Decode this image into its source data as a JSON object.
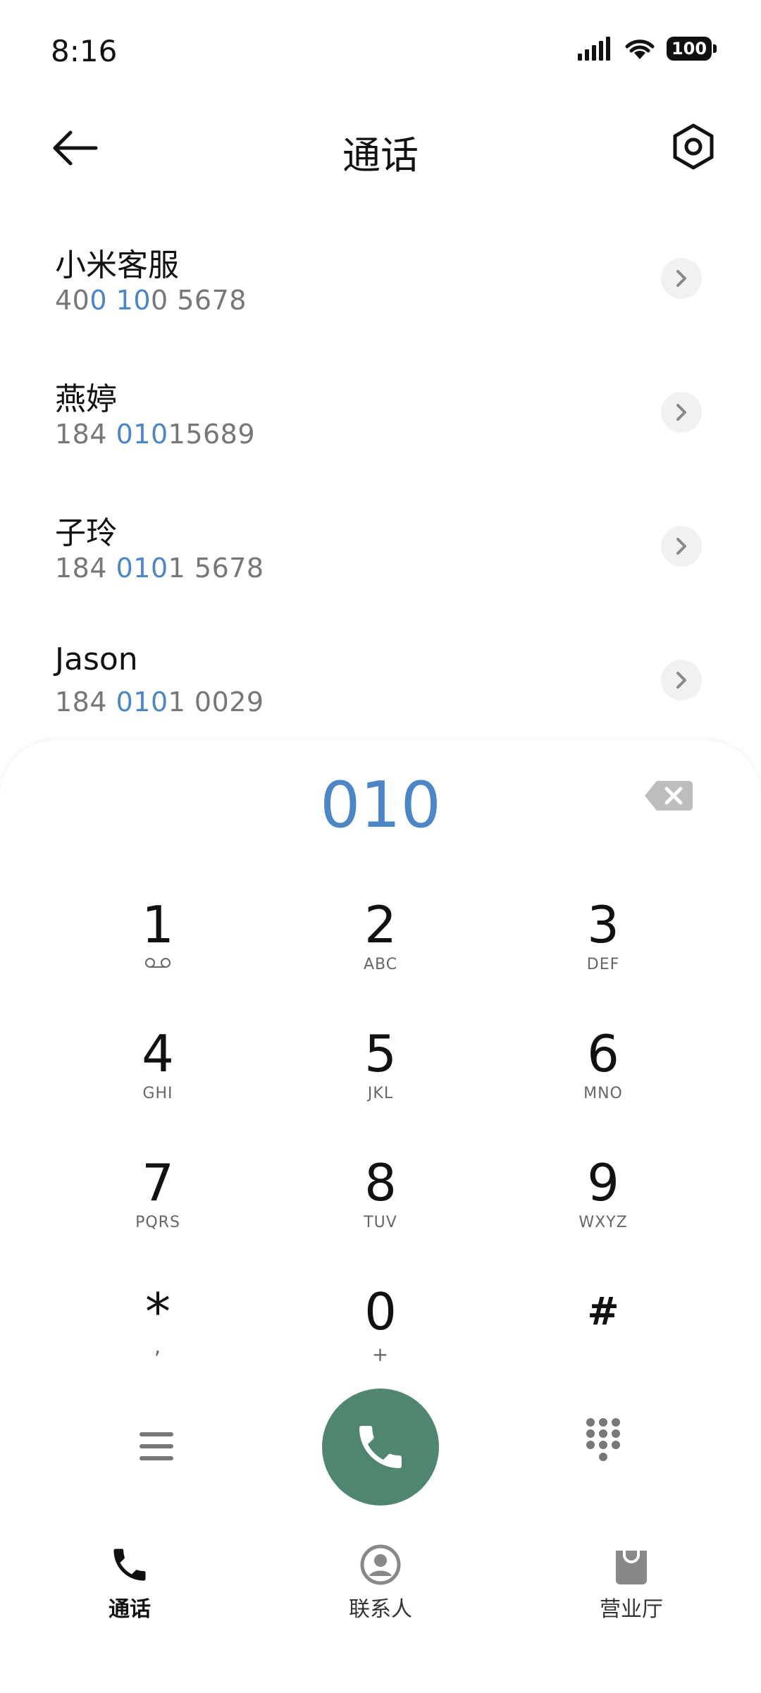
{
  "status_bar": {
    "time": "8:16",
    "battery": "100"
  },
  "header": {
    "title": "通话"
  },
  "contacts": [
    {
      "name": "小米客服",
      "number_parts": [
        "40",
        "0",
        " ",
        "10",
        "0 5678"
      ],
      "highlight": [
        false,
        true,
        false,
        true,
        false
      ]
    },
    {
      "name": "燕婷",
      "number_parts": [
        "184 ",
        "010",
        "15689"
      ],
      "highlight": [
        false,
        true,
        false
      ]
    },
    {
      "name": "子玲",
      "number_parts": [
        "184 ",
        "010",
        "1 5678"
      ],
      "highlight": [
        false,
        true,
        false
      ]
    },
    {
      "name": "Jason",
      "number_parts": [
        "184 ",
        "010",
        "1 0029"
      ],
      "highlight": [
        false,
        true,
        false
      ]
    }
  ],
  "dialer": {
    "input": "010",
    "keys": [
      {
        "digit": "1",
        "letters": ""
      },
      {
        "digit": "2",
        "letters": "ABC"
      },
      {
        "digit": "3",
        "letters": "DEF"
      },
      {
        "digit": "4",
        "letters": "GHI"
      },
      {
        "digit": "5",
        "letters": "JKL"
      },
      {
        "digit": "6",
        "letters": "MNO"
      },
      {
        "digit": "7",
        "letters": "PQRS"
      },
      {
        "digit": "8",
        "letters": "TUV"
      },
      {
        "digit": "9",
        "letters": "WXYZ"
      },
      {
        "digit": "*",
        "letters": ","
      },
      {
        "digit": "0",
        "letters": "+"
      },
      {
        "digit": "#",
        "letters": ""
      }
    ]
  },
  "bottom_nav": {
    "items": [
      {
        "label": "通话",
        "icon": "phone-icon",
        "active": true
      },
      {
        "label": "联系人",
        "icon": "person-icon",
        "active": false
      },
      {
        "label": "营业厅",
        "icon": "shopping-bag-icon",
        "active": false
      }
    ]
  },
  "colors": {
    "accent": "#4a86c8",
    "call_button": "#4f8670"
  }
}
